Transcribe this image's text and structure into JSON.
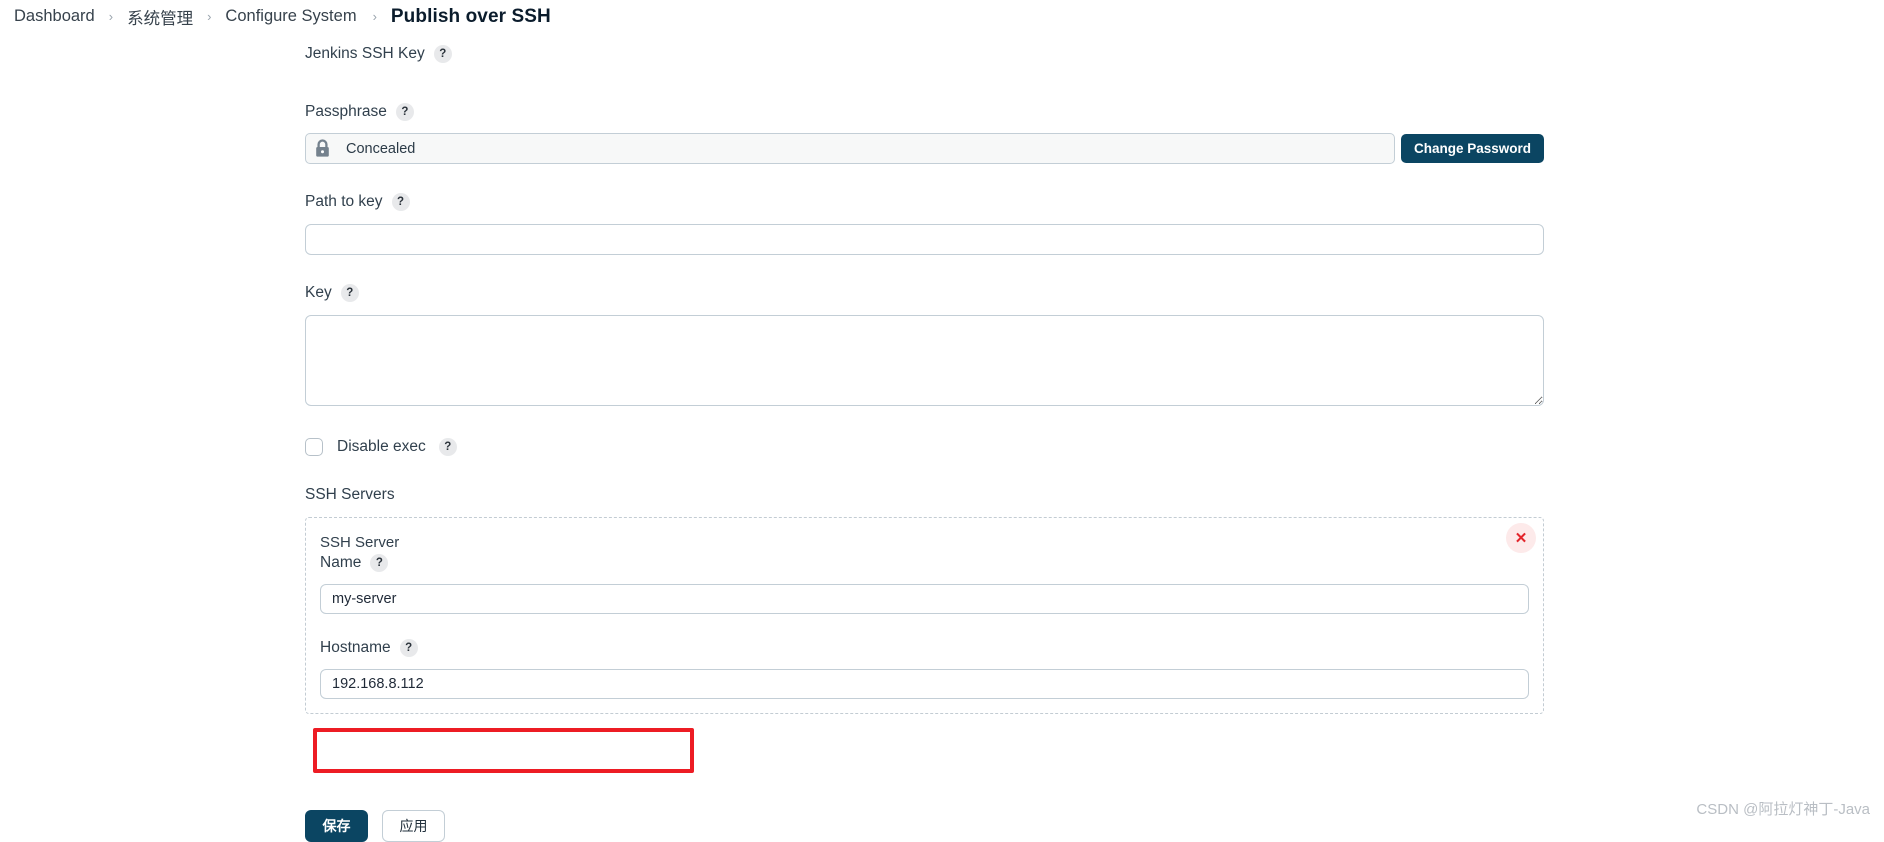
{
  "breadcrumb": {
    "items": [
      {
        "label": "Dashboard"
      },
      {
        "label": "系统管理"
      },
      {
        "label": "Configure System"
      },
      {
        "label": "Publish over SSH"
      }
    ],
    "separator": "›"
  },
  "help_glyph": "?",
  "form": {
    "jenkins_ssh_key": {
      "label": "Jenkins SSH Key"
    },
    "passphrase": {
      "label": "Passphrase",
      "value": "Concealed",
      "lock_icon": "lock-icon",
      "change_button": "Change Password"
    },
    "path_to_key": {
      "label": "Path to key",
      "value": "",
      "placeholder": ""
    },
    "key": {
      "label": "Key",
      "value": "",
      "placeholder": ""
    },
    "disable_exec": {
      "label": "Disable exec",
      "checked": false
    },
    "ssh_servers": {
      "label": "SSH Servers",
      "server": {
        "title": "SSH Server",
        "delete_glyph": "✕",
        "name": {
          "label": "Name",
          "value": "my-server"
        },
        "hostname": {
          "label": "Hostname",
          "value": "192.168.8.112"
        }
      }
    }
  },
  "footer": {
    "save_label": "保存",
    "apply_label": "应用"
  },
  "watermark": "CSDN @阿拉灯神丁-Java",
  "colors": {
    "primary": "#0b4562",
    "annotation_red": "#ed1c24",
    "delete_red": "#e3252b",
    "border": "#c3ced6"
  }
}
